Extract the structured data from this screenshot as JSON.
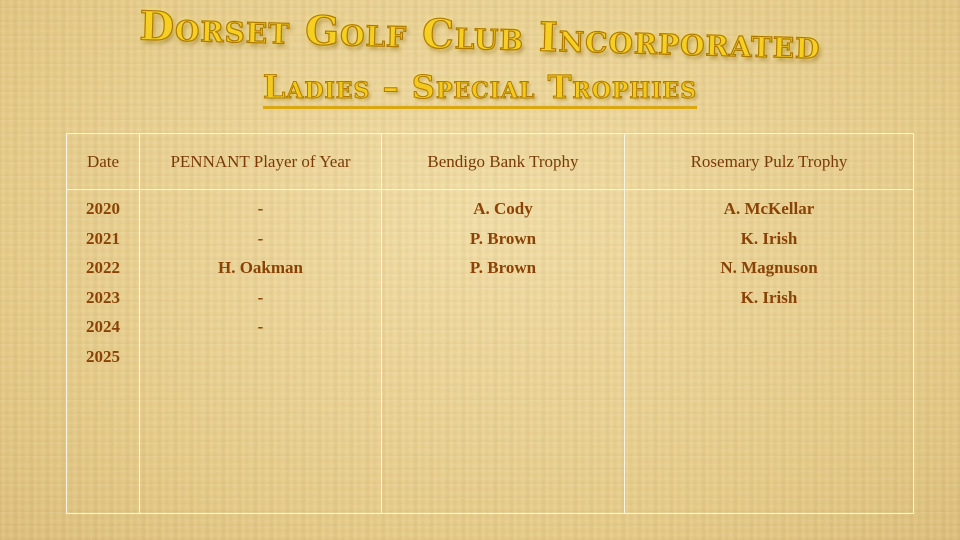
{
  "title": "Dorset Golf Club Incorporated",
  "subtitle": "Ladies – Special Trophies",
  "table": {
    "headers": [
      "Date",
      "PENNANT Player of Year",
      "Bendigo Bank Trophy",
      "Rosemary Pulz Trophy"
    ],
    "rows": [
      [
        "2020",
        "-",
        "A. Cody",
        "A. McKellar"
      ],
      [
        "2021",
        "-",
        "P. Brown",
        "K. Irish"
      ],
      [
        "2022",
        "H. Oakman",
        "P. Brown",
        "N. Magnuson"
      ],
      [
        "2023",
        "-",
        "",
        "K. Irish"
      ],
      [
        "2024",
        "-",
        "",
        ""
      ],
      [
        "2025",
        "",
        "",
        ""
      ]
    ]
  }
}
